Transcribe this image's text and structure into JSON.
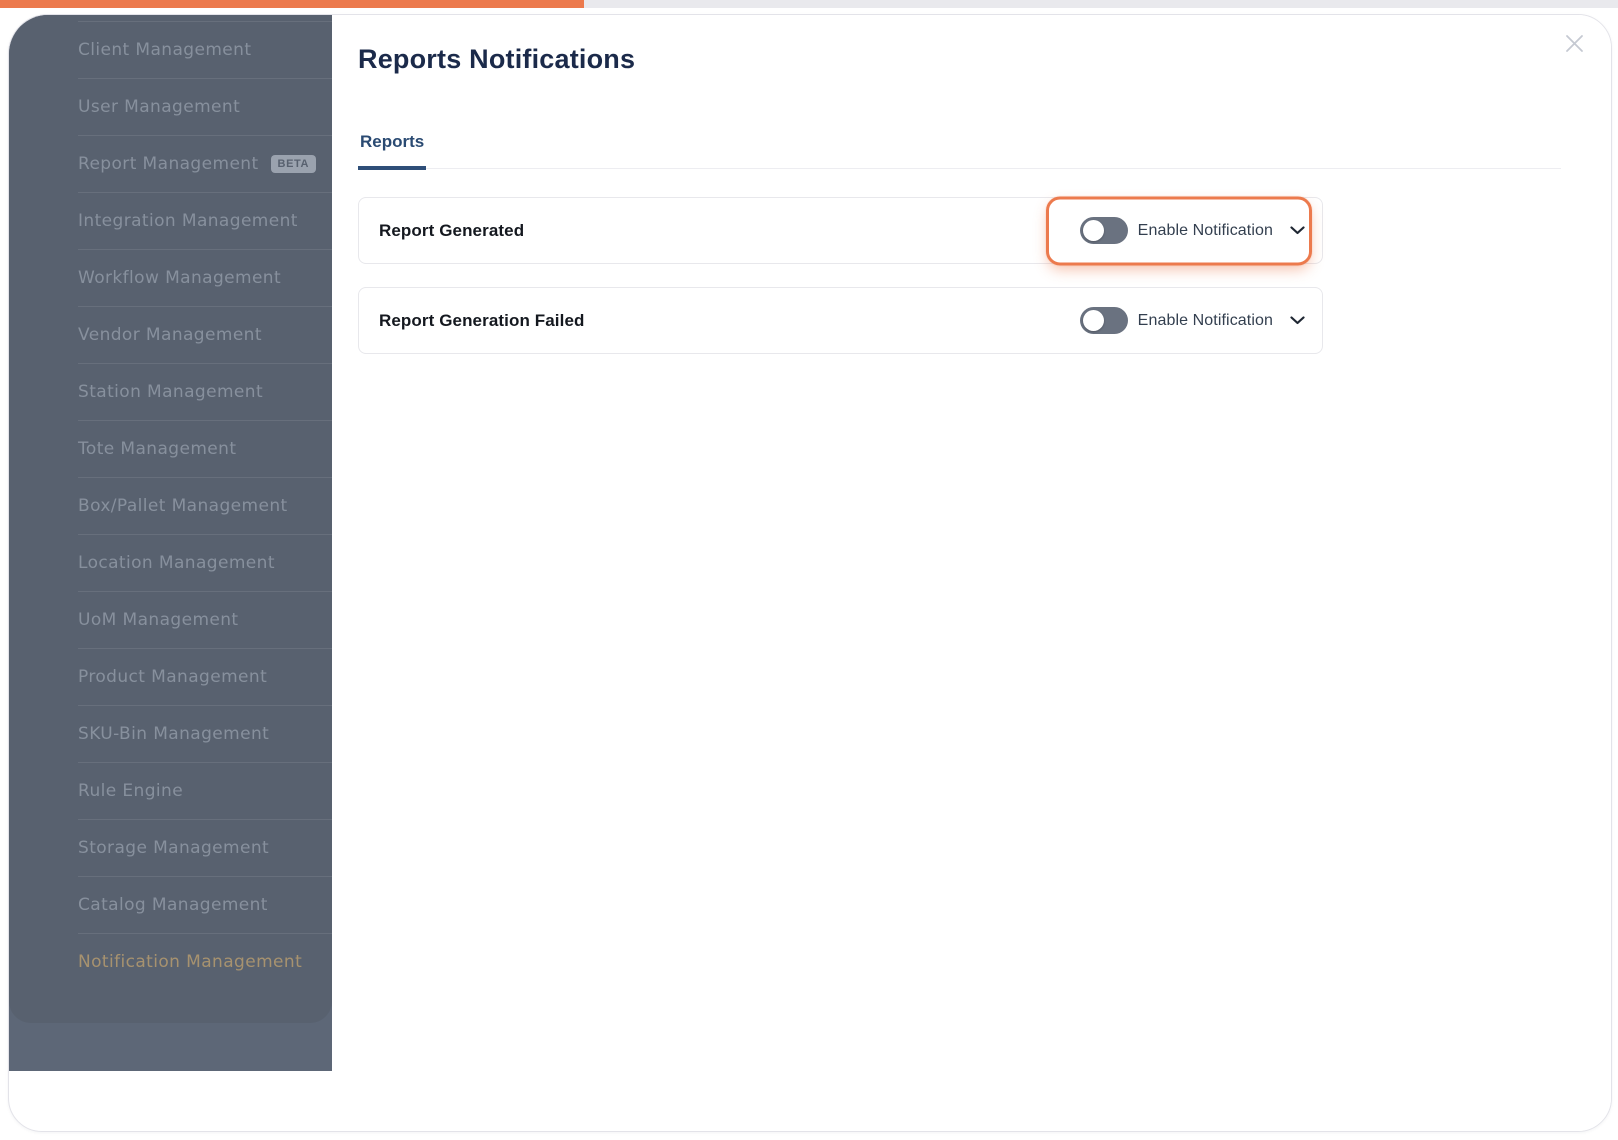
{
  "annotations": {
    "top_progress_color": "#EC7A4D",
    "highlight_color": "#EC7A4D"
  },
  "sidebar": {
    "items": [
      {
        "label": "Client Management"
      },
      {
        "label": "User Management"
      },
      {
        "label": "Report Management",
        "badge": "BETA"
      },
      {
        "label": "Integration Management"
      },
      {
        "label": "Workflow Management"
      },
      {
        "label": "Vendor Management"
      },
      {
        "label": "Station Management"
      },
      {
        "label": "Tote Management"
      },
      {
        "label": "Box/Pallet Management"
      },
      {
        "label": "Location Management"
      },
      {
        "label": "UoM Management"
      },
      {
        "label": "Product Management"
      },
      {
        "label": "SKU-Bin Management"
      },
      {
        "label": "Rule Engine"
      },
      {
        "label": "Storage Management"
      },
      {
        "label": "Catalog Management"
      },
      {
        "label": "Notification Management",
        "active": true
      }
    ]
  },
  "modal": {
    "title": "Reports Notifications",
    "tabs": [
      {
        "label": "Reports",
        "active": true
      }
    ],
    "rows": [
      {
        "label": "Report Generated",
        "toggle": "off",
        "dropdown_label": "Enable Notification",
        "highlighted": true
      },
      {
        "label": "Report Generation Failed",
        "toggle": "off",
        "dropdown_label": "Enable Notification",
        "highlighted": false
      }
    ]
  },
  "colors": {
    "accent_orange": "#EC7A4D",
    "tab_active_blue": "#2E4E78",
    "title_navy": "#1B2A4A",
    "sidebar_bg": "#5D6777",
    "sidebar_panel_bg": "#58616F",
    "sidebar_text": "#87909D",
    "sidebar_active_text": "#A7926F",
    "toggle_off": "#6A7280",
    "row_border": "#E8E8EC"
  }
}
